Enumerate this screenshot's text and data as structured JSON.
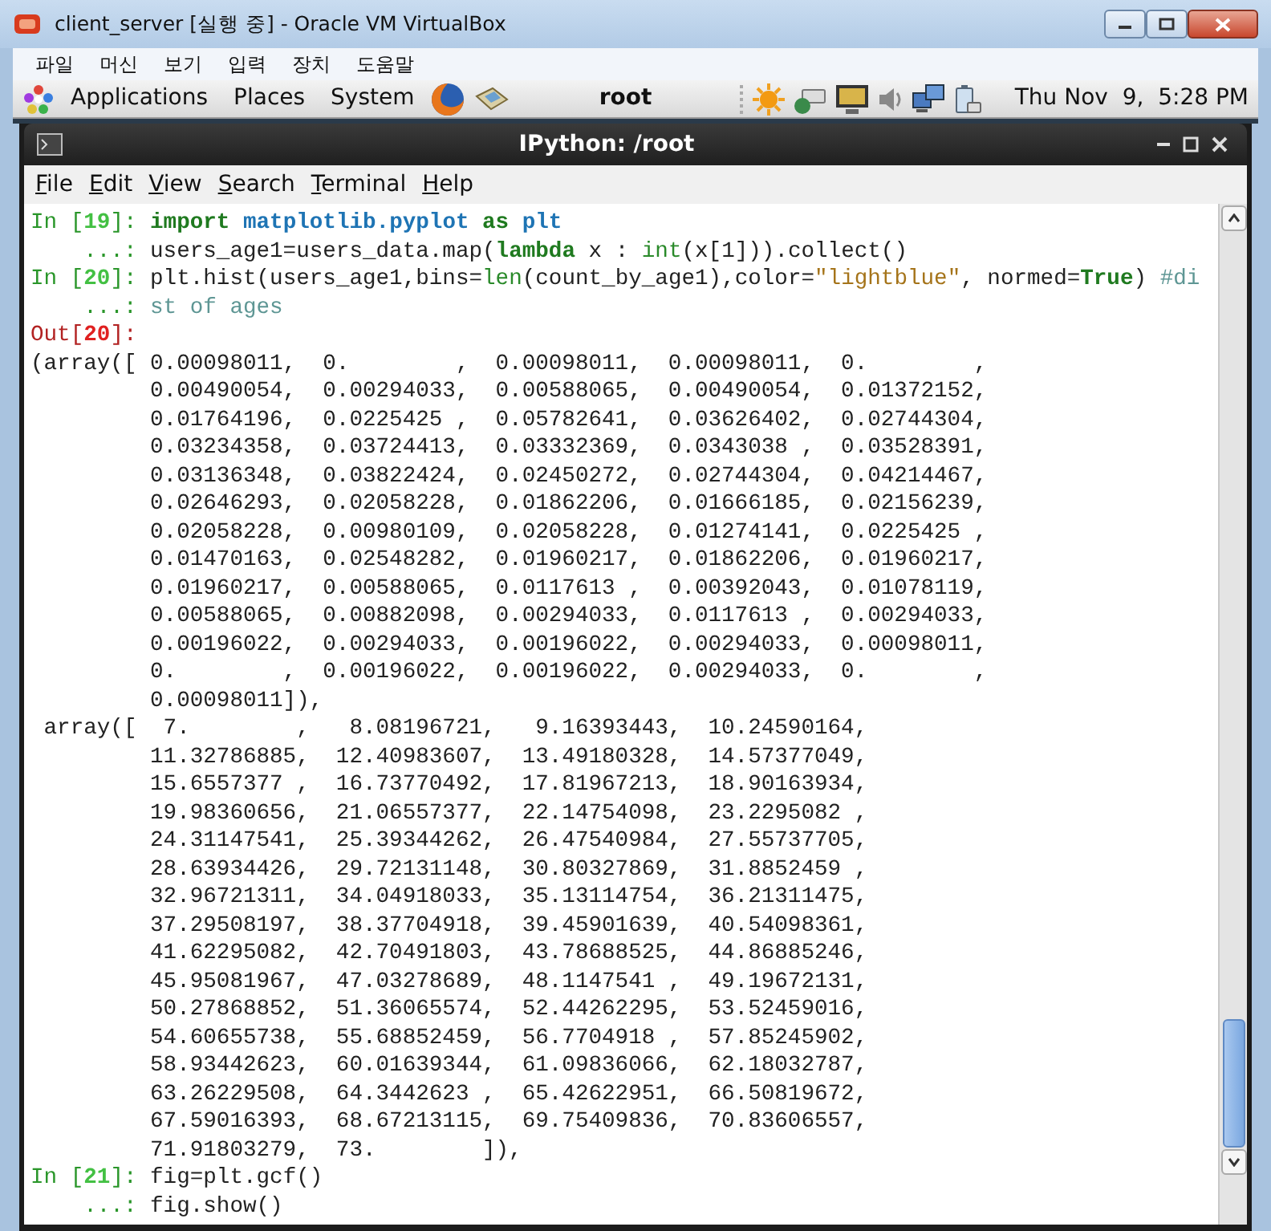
{
  "window": {
    "title": "client_server [실행 중] - Oracle VM VirtualBox"
  },
  "menu": [
    "파일",
    "머신",
    "보기",
    "입력",
    "장치",
    "도움말"
  ],
  "panel": {
    "menus": [
      "Applications",
      "Places",
      "System"
    ],
    "user": "root",
    "clock": "Thu Nov  9,  5:28 PM"
  },
  "terminal": {
    "title": "IPython: /root",
    "menu": [
      "File",
      "Edit",
      "View",
      "Search",
      "Terminal",
      "Help"
    ],
    "lines": [
      {
        "segments": [
          {
            "text": "In [",
            "kind": "prompt"
          },
          {
            "text": "19",
            "kind": "prompt_num"
          },
          {
            "text": "]: ",
            "kind": "prompt"
          },
          {
            "text": "import ",
            "kind": "keyword"
          },
          {
            "text": "matplotlib.pyplot ",
            "kind": "module"
          },
          {
            "text": "as ",
            "kind": "keyword"
          },
          {
            "text": "plt",
            "kind": "module"
          }
        ]
      },
      {
        "segments": [
          {
            "text": "    ...: ",
            "kind": "prompt"
          },
          {
            "text": "users_age1=users_data.map(",
            "kind": "plain"
          },
          {
            "text": "lambda",
            "kind": "keyword"
          },
          {
            "text": " x : ",
            "kind": "plain"
          },
          {
            "text": "int",
            "kind": "builtin"
          },
          {
            "text": "(x[1])).collect()",
            "kind": "plain"
          }
        ]
      },
      {
        "segments": [
          {
            "text": "In [",
            "kind": "prompt"
          },
          {
            "text": "20",
            "kind": "prompt_num"
          },
          {
            "text": "]: ",
            "kind": "prompt"
          },
          {
            "text": "plt.hist(users_age1,bins=",
            "kind": "plain"
          },
          {
            "text": "len",
            "kind": "builtin"
          },
          {
            "text": "(count_by_age1),color=",
            "kind": "plain"
          },
          {
            "text": "\"lightblue\"",
            "kind": "string"
          },
          {
            "text": ", normed=",
            "kind": "plain"
          },
          {
            "text": "True",
            "kind": "keyword"
          },
          {
            "text": ") ",
            "kind": "plain"
          },
          {
            "text": "#di",
            "kind": "comment"
          }
        ]
      },
      {
        "segments": [
          {
            "text": "    ...: ",
            "kind": "prompt"
          },
          {
            "text": "st of ages",
            "kind": "comment"
          }
        ]
      },
      {
        "segments": [
          {
            "text": "Out[",
            "kind": "out"
          },
          {
            "text": "20",
            "kind": "out_num"
          },
          {
            "text": "]:",
            "kind": "out"
          }
        ]
      },
      {
        "segments": [
          {
            "text": "(array([ 0.00098011,  0.        ,  0.00098011,  0.00098011,  0.        ,",
            "kind": "plain"
          }
        ]
      },
      {
        "segments": [
          {
            "text": "         0.00490054,  0.00294033,  0.00588065,  0.00490054,  0.01372152,",
            "kind": "plain"
          }
        ]
      },
      {
        "segments": [
          {
            "text": "         0.01764196,  0.0225425 ,  0.05782641,  0.03626402,  0.02744304,",
            "kind": "plain"
          }
        ]
      },
      {
        "segments": [
          {
            "text": "         0.03234358,  0.03724413,  0.03332369,  0.0343038 ,  0.03528391,",
            "kind": "plain"
          }
        ]
      },
      {
        "segments": [
          {
            "text": "         0.03136348,  0.03822424,  0.02450272,  0.02744304,  0.04214467,",
            "kind": "plain"
          }
        ]
      },
      {
        "segments": [
          {
            "text": "         0.02646293,  0.02058228,  0.01862206,  0.01666185,  0.02156239,",
            "kind": "plain"
          }
        ]
      },
      {
        "segments": [
          {
            "text": "         0.02058228,  0.00980109,  0.02058228,  0.01274141,  0.0225425 ,",
            "kind": "plain"
          }
        ]
      },
      {
        "segments": [
          {
            "text": "         0.01470163,  0.02548282,  0.01960217,  0.01862206,  0.01960217,",
            "kind": "plain"
          }
        ]
      },
      {
        "segments": [
          {
            "text": "         0.01960217,  0.00588065,  0.0117613 ,  0.00392043,  0.01078119,",
            "kind": "plain"
          }
        ]
      },
      {
        "segments": [
          {
            "text": "         0.00588065,  0.00882098,  0.00294033,  0.0117613 ,  0.00294033,",
            "kind": "plain"
          }
        ]
      },
      {
        "segments": [
          {
            "text": "         0.00196022,  0.00294033,  0.00196022,  0.00294033,  0.00098011,",
            "kind": "plain"
          }
        ]
      },
      {
        "segments": [
          {
            "text": "         0.        ,  0.00196022,  0.00196022,  0.00294033,  0.        ,",
            "kind": "plain"
          }
        ]
      },
      {
        "segments": [
          {
            "text": "         0.00098011]),",
            "kind": "plain"
          }
        ]
      },
      {
        "segments": [
          {
            "text": " array([  7.        ,   8.08196721,   9.16393443,  10.24590164,",
            "kind": "plain"
          }
        ]
      },
      {
        "segments": [
          {
            "text": "         11.32786885,  12.40983607,  13.49180328,  14.57377049,",
            "kind": "plain"
          }
        ]
      },
      {
        "segments": [
          {
            "text": "         15.6557377 ,  16.73770492,  17.81967213,  18.90163934,",
            "kind": "plain"
          }
        ]
      },
      {
        "segments": [
          {
            "text": "         19.98360656,  21.06557377,  22.14754098,  23.2295082 ,",
            "kind": "plain"
          }
        ]
      },
      {
        "segments": [
          {
            "text": "         24.31147541,  25.39344262,  26.47540984,  27.55737705,",
            "kind": "plain"
          }
        ]
      },
      {
        "segments": [
          {
            "text": "         28.63934426,  29.72131148,  30.80327869,  31.8852459 ,",
            "kind": "plain"
          }
        ]
      },
      {
        "segments": [
          {
            "text": "         32.96721311,  34.04918033,  35.13114754,  36.21311475,",
            "kind": "plain"
          }
        ]
      },
      {
        "segments": [
          {
            "text": "         37.29508197,  38.37704918,  39.45901639,  40.54098361,",
            "kind": "plain"
          }
        ]
      },
      {
        "segments": [
          {
            "text": "         41.62295082,  42.70491803,  43.78688525,  44.86885246,",
            "kind": "plain"
          }
        ]
      },
      {
        "segments": [
          {
            "text": "         45.95081967,  47.03278689,  48.1147541 ,  49.19672131,",
            "kind": "plain"
          }
        ]
      },
      {
        "segments": [
          {
            "text": "         50.27868852,  51.36065574,  52.44262295,  53.52459016,",
            "kind": "plain"
          }
        ]
      },
      {
        "segments": [
          {
            "text": "         54.60655738,  55.68852459,  56.7704918 ,  57.85245902,",
            "kind": "plain"
          }
        ]
      },
      {
        "segments": [
          {
            "text": "         58.93442623,  60.01639344,  61.09836066,  62.18032787,",
            "kind": "plain"
          }
        ]
      },
      {
        "segments": [
          {
            "text": "         63.26229508,  64.3442623 ,  65.42622951,  66.50819672,",
            "kind": "plain"
          }
        ]
      },
      {
        "segments": [
          {
            "text": "         67.59016393,  68.67213115,  69.75409836,  70.83606557,",
            "kind": "plain"
          }
        ]
      },
      {
        "segments": [
          {
            "text": "         71.91803279,  73.        ]),",
            "kind": "plain"
          }
        ]
      },
      {
        "segments": [
          {
            "text": "In [",
            "kind": "prompt"
          },
          {
            "text": "21",
            "kind": "prompt_num"
          },
          {
            "text": "]: ",
            "kind": "prompt"
          },
          {
            "text": "fig=plt.gcf()",
            "kind": "plain"
          }
        ]
      },
      {
        "segments": [
          {
            "text": "    ...: ",
            "kind": "prompt"
          },
          {
            "text": "fig.show()",
            "kind": "plain"
          }
        ]
      }
    ]
  }
}
